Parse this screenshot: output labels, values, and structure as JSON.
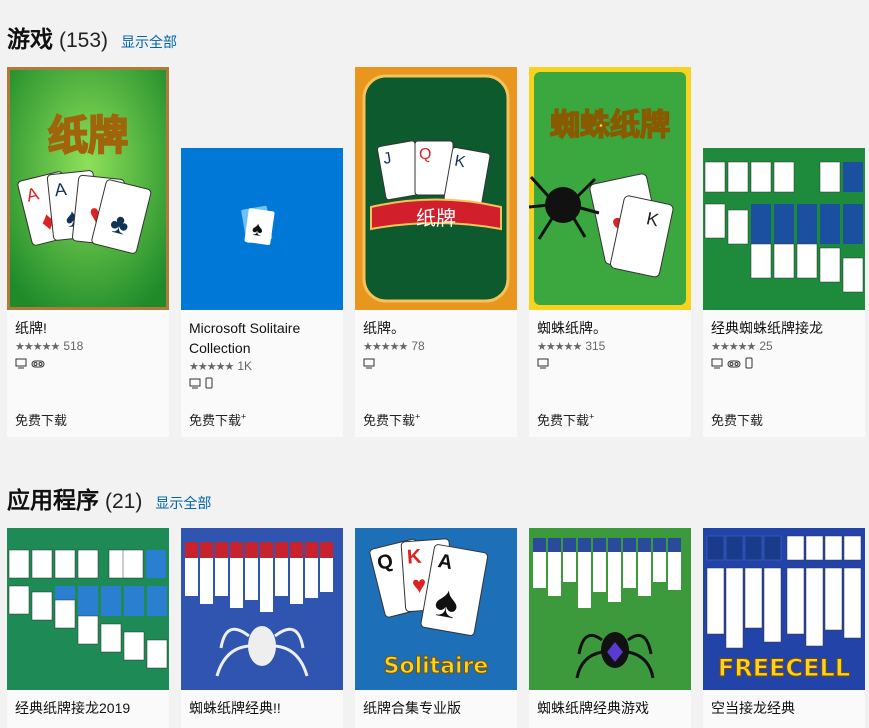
{
  "games": {
    "title": "游戏",
    "count": "(153)",
    "show_all": "显示全部",
    "items": [
      {
        "name": "纸牌!",
        "stars": "★★★★★",
        "reviews": "518",
        "devices": [
          "pc-icon",
          "vr-headset-icon"
        ],
        "price": "免费下载",
        "price_mark": "",
        "tile_text": "纸牌"
      },
      {
        "name": "Microsoft Solitaire Collection",
        "stars": "★★★★★",
        "reviews": "1K",
        "devices": [
          "pc-icon",
          "phone-icon"
        ],
        "price": "免费下载",
        "price_mark": "+"
      },
      {
        "name": "纸牌。",
        "stars": "★★★★★",
        "reviews": "78",
        "devices": [
          "pc-icon"
        ],
        "price": "免费下载",
        "price_mark": "+",
        "tile_text": "纸牌"
      },
      {
        "name": "蜘蛛纸牌。",
        "stars": "★★★★★",
        "reviews": "315",
        "devices": [
          "pc-icon"
        ],
        "price": "免费下载",
        "price_mark": "+",
        "tile_text": "蜘蛛纸牌"
      },
      {
        "name": "经典蜘蛛纸牌接龙",
        "stars": "★★★★★",
        "reviews": "25",
        "devices": [
          "pc-icon",
          "vr-headset-icon",
          "phone-icon"
        ],
        "price": "免费下载",
        "price_mark": ""
      }
    ]
  },
  "apps": {
    "title": "应用程序",
    "count": "(21)",
    "show_all": "显示全部",
    "items": [
      {
        "name": "经典纸牌接龙2019"
      },
      {
        "name": "蜘蛛纸牌经典!!"
      },
      {
        "name": "纸牌合集专业版",
        "tile_text": "Solitaire"
      },
      {
        "name": "蜘蛛纸牌经典游戏"
      },
      {
        "name": "空当接龙经典",
        "tile_text": "FREECELL"
      }
    ]
  },
  "colors": {
    "accent": "#0063b1",
    "msc_blue": "#0078d7",
    "felt_green": "#1e8a3c"
  }
}
